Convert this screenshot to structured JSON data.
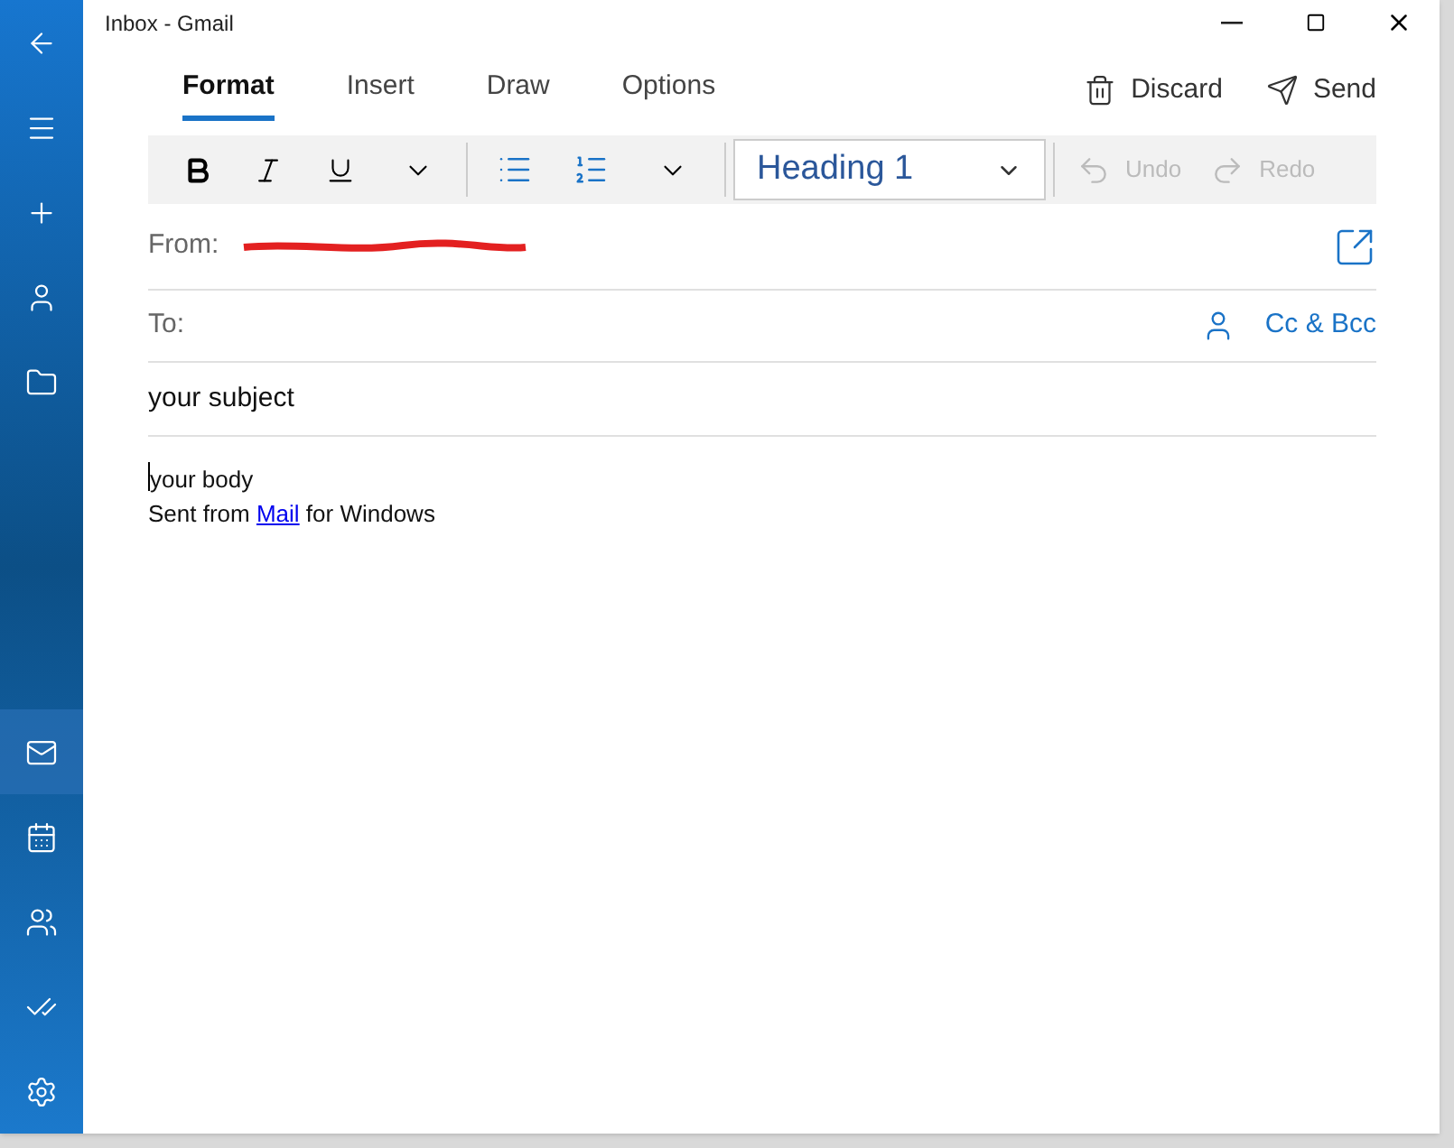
{
  "window": {
    "title": "Inbox - Gmail"
  },
  "nav_top": [
    {
      "kind": "back"
    },
    {
      "kind": "menu"
    },
    {
      "kind": "compose"
    },
    {
      "kind": "account"
    },
    {
      "kind": "folder"
    }
  ],
  "nav_bottom": [
    {
      "kind": "mail",
      "selected": true
    },
    {
      "kind": "calendar",
      "selected": false
    },
    {
      "kind": "people",
      "selected": false
    },
    {
      "kind": "todo",
      "selected": false
    },
    {
      "kind": "settings",
      "selected": false
    }
  ],
  "tabs": [
    {
      "label": "Format",
      "selected": true
    },
    {
      "label": "Insert",
      "selected": false
    },
    {
      "label": "Draw",
      "selected": false
    },
    {
      "label": "Options",
      "selected": false
    }
  ],
  "actions": [
    {
      "kind": "discard",
      "label": "Discard"
    },
    {
      "kind": "send",
      "label": "Send"
    }
  ],
  "toolbar": {
    "style": "Heading 1",
    "undo": {
      "label": "Undo",
      "disabled": true
    },
    "redo": {
      "label": "Redo",
      "disabled": true
    }
  },
  "from": {
    "label": "From:",
    "redacted": true
  },
  "to": {
    "label": "To:",
    "cc_bcc": "Cc & Bcc"
  },
  "subject": "your subject",
  "body": {
    "text": "your body",
    "signature_before": "Sent from ",
    "signature_link": "Mail",
    "signature_after": " for Windows"
  }
}
